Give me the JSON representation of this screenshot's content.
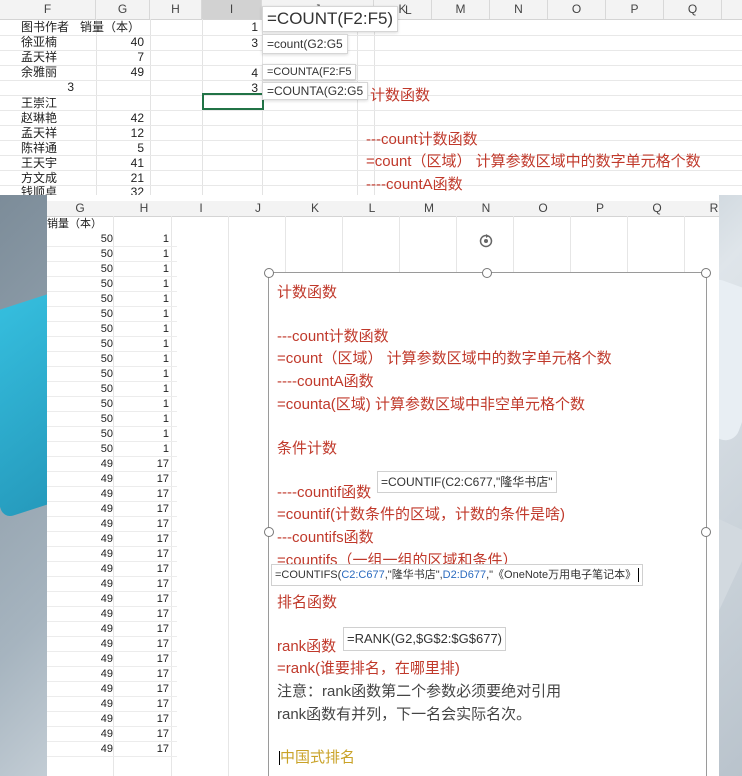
{
  "top_sheet": {
    "columns": [
      "F",
      "G",
      "H",
      "I",
      "J",
      "K",
      "L",
      "M",
      "N",
      "O",
      "P",
      "Q"
    ],
    "header_row": [
      "图书作者",
      "销量（本）"
    ],
    "rows": [
      {
        "f": "徐亚楠",
        "g": "40"
      },
      {
        "f": "孟天祥",
        "g": "7"
      },
      {
        "f": "余雅丽",
        "g": "49"
      },
      {
        "f": "3",
        "g": ""
      },
      {
        "f": "王崇江",
        "g": ""
      },
      {
        "f": "赵琳艳",
        "g": "42"
      },
      {
        "f": "孟天祥",
        "g": "12"
      },
      {
        "f": "陈祥通",
        "g": "5"
      },
      {
        "f": "王天宇",
        "g": "41"
      },
      {
        "f": "方文成",
        "g": "21"
      },
      {
        "f": "钱顺卓",
        "g": "32"
      }
    ],
    "i_values": [
      "1",
      "3",
      "4",
      "3"
    ],
    "formula_big": "=COUNT(F2:F5)",
    "formula_small1": "=count(G2:G5",
    "formula_small2": "=COUNTA(F2:F5",
    "formula_small3": "=COUNTA(G2:G5",
    "side_texts": [
      "计数函数",
      "---count计数函数",
      "=count（区域） 计算参数区域中的数字单元格个数",
      "----countA函数"
    ]
  },
  "bottom_sheet": {
    "columns": [
      "G",
      "H",
      "I",
      "J",
      "K",
      "L",
      "M",
      "N",
      "O",
      "P",
      "Q",
      "R"
    ],
    "first_label": "销量（本）",
    "g_values": [
      "50",
      "50",
      "50",
      "50",
      "50",
      "50",
      "50",
      "50",
      "50",
      "50",
      "50",
      "50",
      "50",
      "50",
      "50",
      "49",
      "49",
      "49",
      "49",
      "49",
      "49",
      "49",
      "49",
      "49",
      "49",
      "49",
      "49",
      "49",
      "49",
      "49",
      "49",
      "49",
      "49",
      "49",
      "49"
    ],
    "h_values": [
      "1",
      "1",
      "1",
      "1",
      "1",
      "1",
      "1",
      "1",
      "1",
      "1",
      "1",
      "1",
      "1",
      "1",
      "1",
      "17",
      "17",
      "17",
      "17",
      "17",
      "17",
      "17",
      "17",
      "17",
      "17",
      "17",
      "17",
      "17",
      "17",
      "17",
      "17",
      "17",
      "17",
      "17",
      "17"
    ],
    "textbox": {
      "title": "计数函数",
      "line1": "---count计数函数",
      "line2": "=count（区域） 计算参数区域中的数字单元格个数",
      "line3": "----countA函数",
      "line4": "=counta(区域) 计算参数区域中非空单元格个数",
      "title2": "条件计数",
      "line5": "----countif函数",
      "chip1": "=COUNTIF(C2:C677,\"隆华书店\"",
      "line6": "=countif(计数条件的区域，计数的条件是啥)",
      "line7": "---countifs函数",
      "line8": "=countifs（一组一组的区域和条件）",
      "chip2_a": "=COUNTIFS(",
      "chip2_b": "C2:C677",
      "chip2_c": ",\"隆华书店\",",
      "chip2_d": "D2:D677",
      "chip2_e": ",\"《OneNote万用电子笔记本》",
      "title3": "排名函数",
      "line9": "rank函数",
      "chip3": "=RANK(G2,$G$2:$G$677)",
      "line10": "=rank(谁要排名，在哪里排)",
      "line11": "注意：rank函数第二个参数必须要绝对引用",
      "line12": "rank函数有并列，下一名会实际名次。",
      "line13": "中国式排名"
    }
  },
  "colors": {
    "accent_red": "#c0392b",
    "excel_green": "#217346",
    "gold": "#c9a227"
  }
}
